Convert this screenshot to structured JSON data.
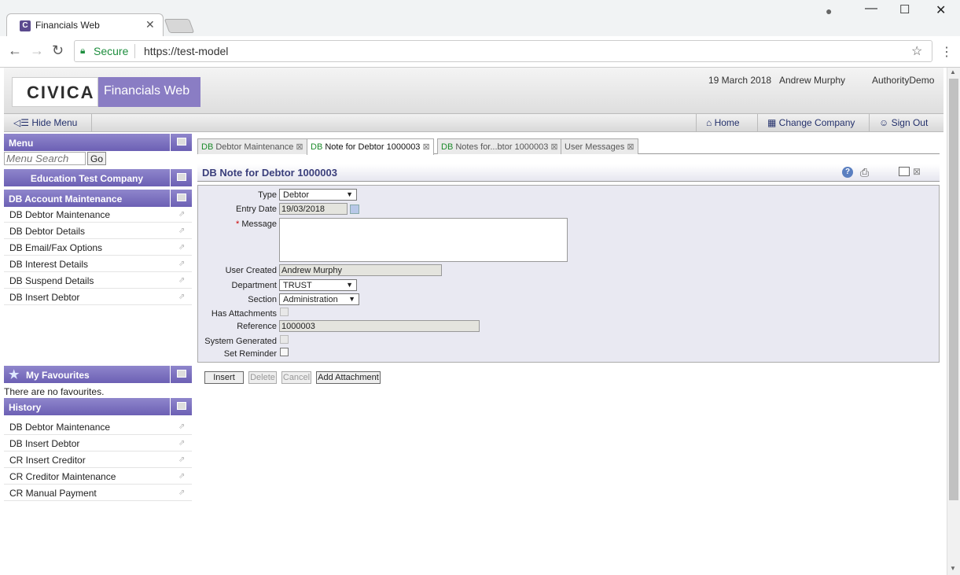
{
  "browser": {
    "tab_title": "Financials Web",
    "tab_favicon": "C",
    "secure_label": "Secure",
    "url": "https://test-model"
  },
  "header": {
    "logo": "CIVICA",
    "app_name": "Financials Web",
    "date": "19 March 2018",
    "user": "Andrew Murphy",
    "authority": "AuthorityDemo"
  },
  "nav": {
    "hide_menu": "Hide Menu",
    "home": "Home",
    "change_company": "Change Company",
    "sign_out": "Sign Out"
  },
  "sidebar": {
    "menu_title": "Menu",
    "search_placeholder": "Menu Search",
    "go_label": "Go",
    "company": "Education Test Company",
    "section_title": "DB Account Maintenance",
    "items": [
      {
        "label": "DB Debtor Maintenance"
      },
      {
        "label": "DB Debtor Details"
      },
      {
        "label": "DB Email/Fax Options"
      },
      {
        "label": "DB Interest Details"
      },
      {
        "label": "DB Suspend Details"
      },
      {
        "label": "DB Insert Debtor"
      }
    ],
    "favourites_title": "My Favourites",
    "favourites_empty": "There are no favourites.",
    "history_title": "History",
    "history": [
      {
        "label": "DB Debtor Maintenance"
      },
      {
        "label": "DB Insert Debtor"
      },
      {
        "label": "CR Insert Creditor"
      },
      {
        "label": "CR Creditor Maintenance"
      },
      {
        "label": "CR Manual Payment"
      }
    ]
  },
  "tabs": [
    {
      "prefix": "DB",
      "label": "Debtor Maintenance"
    },
    {
      "prefix": "DB",
      "label": "Note for Debtor 1000003"
    },
    {
      "prefix": "DB",
      "label": "Notes for...btor 1000003"
    },
    {
      "prefix": "",
      "label": "User Messages"
    }
  ],
  "form": {
    "title": "DB Note for Debtor 1000003",
    "labels": {
      "type": "Type",
      "entry_date": "Entry Date",
      "message": "Message",
      "user_created": "User Created",
      "department": "Department",
      "section": "Section",
      "has_attachments": "Has Attachments",
      "reference": "Reference",
      "system_generated": "System Generated",
      "set_reminder": "Set Reminder"
    },
    "required_marker": "*",
    "values": {
      "type": "Debtor",
      "entry_date": "19/03/2018",
      "message": "",
      "user_created": "Andrew Murphy",
      "department": "TRUST",
      "section": "Administration",
      "reference": "1000003"
    }
  },
  "buttons": {
    "insert": "Insert",
    "delete": "Delete",
    "cancel": "Cancel",
    "add_attachment": "Add Attachment"
  },
  "colors": {
    "brand_purple": "#8a7dc4",
    "panel_header": "#6c60b4",
    "form_title": "#3a3e7b"
  }
}
